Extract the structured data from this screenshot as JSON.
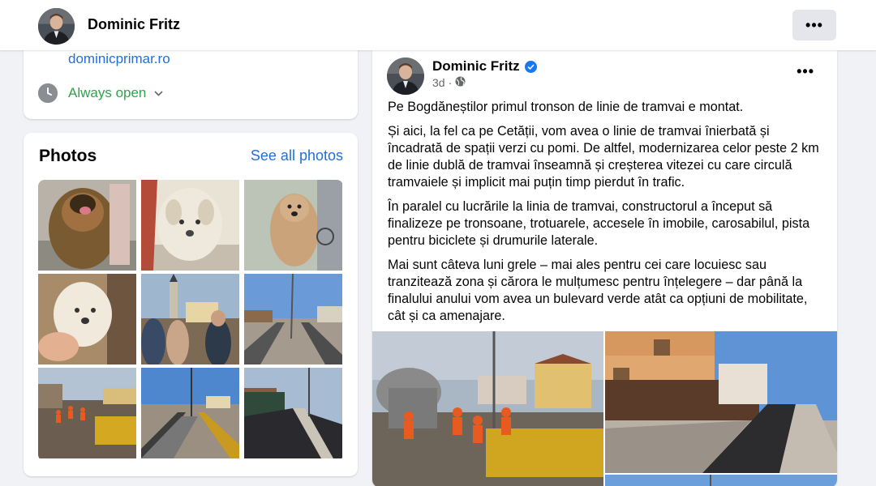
{
  "topbar": {
    "page_name": "Dominic Fritz",
    "more_label": "•••"
  },
  "intro": {
    "website": "dominicprimar.ro",
    "hours": "Always open"
  },
  "photos": {
    "title": "Photos",
    "see_all": "See all photos",
    "items": [
      "dog-photo-1",
      "dog-photo-2",
      "dog-photo-3",
      "dog-photo-4",
      "town-square-photo",
      "tramway-photo-1",
      "tramway-photo-2",
      "tramway-photo-3",
      "tramway-photo-4"
    ]
  },
  "post": {
    "author": "Dominic Fritz",
    "time": "3d",
    "more_label": "•••",
    "paragraphs": [
      "Pe Bogdăneștilor primul tronson de linie de tramvai e montat.",
      "Și aici, la fel ca pe Cetății, vom avea o linie de tramvai înierbată și încadrată de spații verzi cu pomi. De altfel, modernizarea celor peste 2 km de linie dublă de tramvai înseamnă și creșterea vitezei cu care circulă tramvaiele și implicit mai puțin timp pierdut în trafic.",
      "În paralel cu lucrările la linia de tramvai, constructorul a început să finalizeze pe tronsoane, trotuarele, accesele în imobile, carosabilul, pista pentru biciclete și drumurile laterale.",
      "Mai sunt câteva luni grele – mai ales pentru cei care locuiesc sau tranzitează zona și cărora le mulțumesc pentru înțelegere – dar până la finalului anului vom avea un bulevard verde atât ca opțiuni de mobilitate, cât și ca amenajare."
    ]
  },
  "colors": {
    "link": "#216fdb",
    "open": "#31a24c",
    "verified": "#1877f2"
  }
}
